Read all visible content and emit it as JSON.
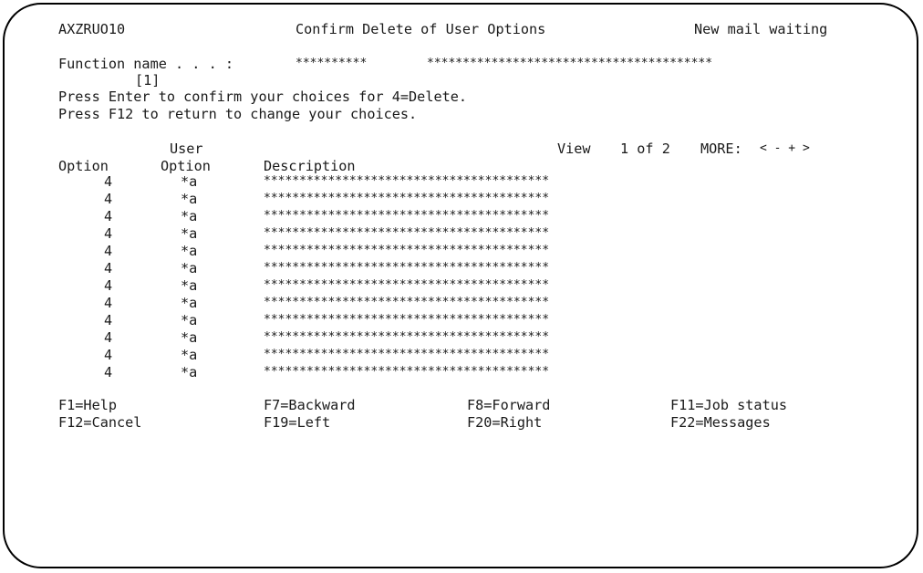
{
  "header": {
    "program_id": "AXZRUO10",
    "title": "Confirm Delete of User Options",
    "status": "New mail waiting"
  },
  "function": {
    "label": "Function name . . . :",
    "value1": "**********",
    "value2": "****************************************",
    "callout": "[1]"
  },
  "instructions": [
    "Press Enter to confirm your choices for 4=Delete.",
    "Press F12 to return to change your choices."
  ],
  "view": {
    "label": "View",
    "page": "1 of 2",
    "more_label": "MORE:",
    "more_controls": "< - + >"
  },
  "columns": {
    "user_top": "User",
    "option": "Option",
    "user_option": "Option",
    "description": "Description"
  },
  "rows": [
    {
      "option": "4",
      "user_option": "*a",
      "description": "****************************************"
    },
    {
      "option": "4",
      "user_option": "*a",
      "description": "****************************************"
    },
    {
      "option": "4",
      "user_option": "*a",
      "description": "****************************************"
    },
    {
      "option": "4",
      "user_option": "*a",
      "description": "****************************************"
    },
    {
      "option": "4",
      "user_option": "*a",
      "description": "****************************************"
    },
    {
      "option": "4",
      "user_option": "*a",
      "description": "****************************************"
    },
    {
      "option": "4",
      "user_option": "*a",
      "description": "****************************************"
    },
    {
      "option": "4",
      "user_option": "*a",
      "description": "****************************************"
    },
    {
      "option": "4",
      "user_option": "*a",
      "description": "****************************************"
    },
    {
      "option": "4",
      "user_option": "*a",
      "description": "****************************************"
    },
    {
      "option": "4",
      "user_option": "*a",
      "description": "****************************************"
    },
    {
      "option": "4",
      "user_option": "*a",
      "description": "****************************************"
    }
  ],
  "function_keys": [
    {
      "key": "F1=Help"
    },
    {
      "key": "F7=Backward"
    },
    {
      "key": "F8=Forward"
    },
    {
      "key": "F11=Job status"
    },
    {
      "key": "F12=Cancel"
    },
    {
      "key": "F19=Left"
    },
    {
      "key": "F20=Right"
    },
    {
      "key": "F22=Messages"
    }
  ]
}
